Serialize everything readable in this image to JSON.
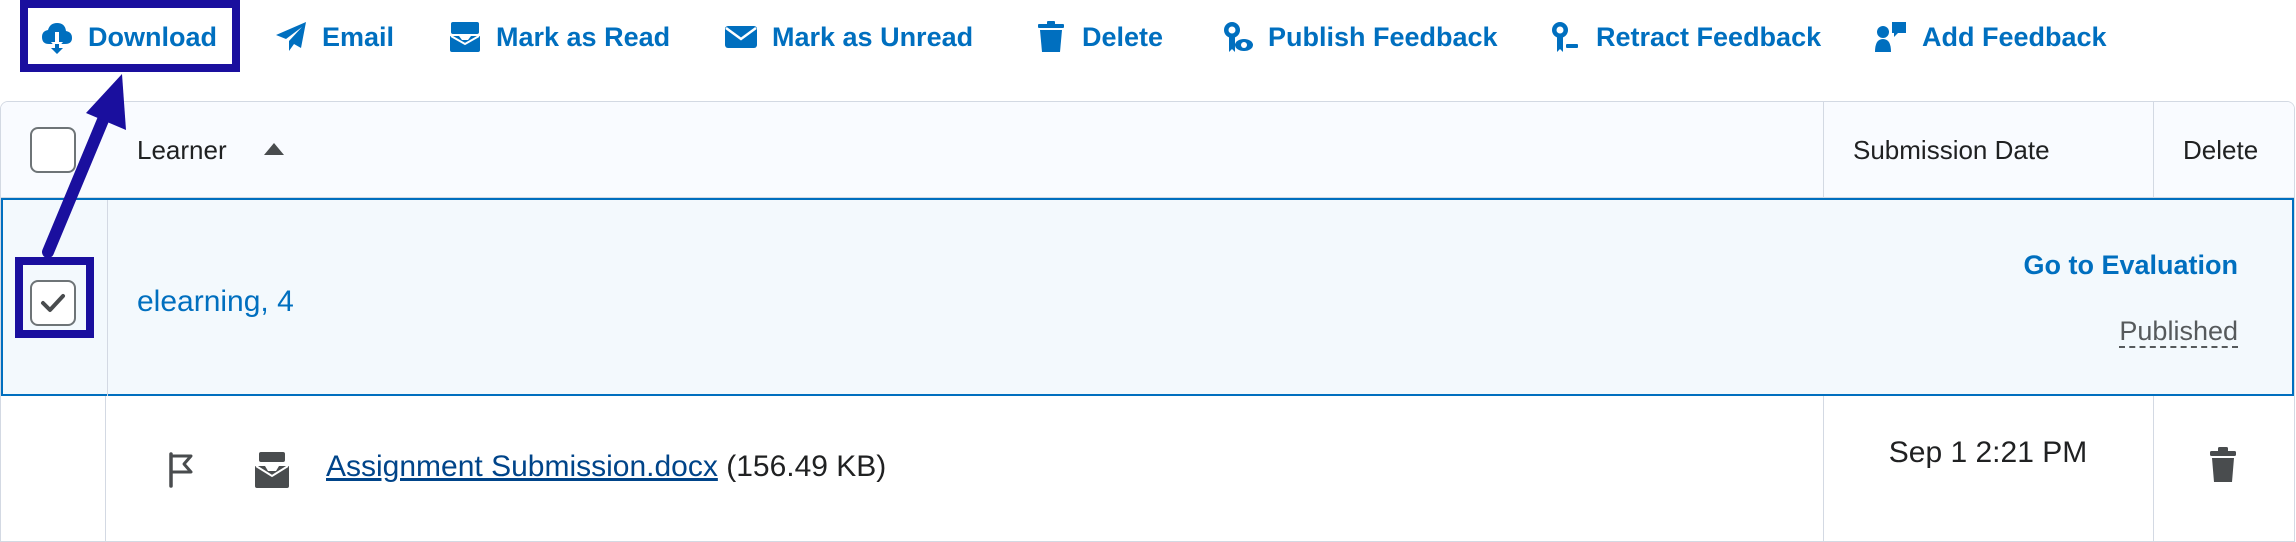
{
  "toolbar": {
    "download": "Download",
    "email": "Email",
    "mark_read": "Mark as Read",
    "mark_unread": "Mark as Unread",
    "delete": "Delete",
    "publish_feedback": "Publish Feedback",
    "retract_feedback": "Retract Feedback",
    "add_feedback": "Add Feedback"
  },
  "table": {
    "headers": {
      "learner": "Learner",
      "submission_date": "Submission Date",
      "delete": "Delete"
    },
    "row": {
      "learner_name": "elearning, 4",
      "go_to_evaluation": "Go to Evaluation",
      "status": "Published",
      "checked": true
    },
    "file": {
      "name": "Assignment Submission.docx",
      "size": "(156.49 KB)",
      "date": "Sep 1 2:21 PM"
    }
  },
  "colors": {
    "accent": "#006fbf",
    "annotation": "#1a0f9e",
    "selected_row_bg": "#f3f9fd"
  },
  "icons": [
    "download-icon",
    "email-icon",
    "mark-read-icon",
    "mark-unread-icon",
    "trash-icon",
    "publish-feedback-icon",
    "retract-feedback-icon",
    "add-feedback-icon",
    "sort-up-icon",
    "checkmark-icon",
    "flag-icon",
    "inbox-icon"
  ]
}
